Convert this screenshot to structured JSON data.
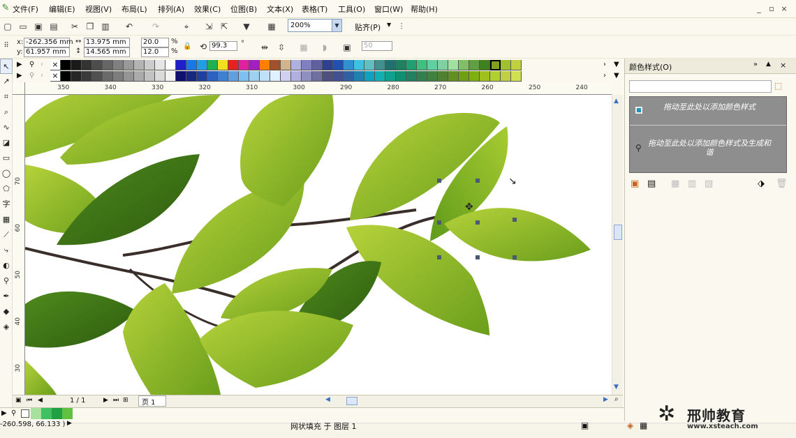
{
  "menubar": {
    "items": [
      "文件(F)",
      "编辑(E)",
      "视图(V)",
      "布局(L)",
      "排列(A)",
      "效果(C)",
      "位图(B)",
      "文本(X)",
      "表格(T)",
      "工具(O)",
      "窗口(W)",
      "帮助(H)"
    ],
    "win_controls": [
      "_",
      "▫",
      "×"
    ]
  },
  "toolbar": {
    "zoom_value": "200%",
    "snap_label": "贴齐(P)"
  },
  "property_bar": {
    "x_label": "x:",
    "y_label": "y:",
    "x_value": "-262.356 mm",
    "y_value": "61.957 mm",
    "width_value": "13.975 mm",
    "height_value": "14.565 mm",
    "scale_w": "20.0",
    "scale_h": "12.0",
    "percent": "%",
    "rotation_value": "99.3",
    "degree": "°",
    "disabled_value": "50"
  },
  "palette": {
    "row1": [
      "#000000",
      "#1a1a1a",
      "#333333",
      "#4d4d4d",
      "#666666",
      "#808080",
      "#999999",
      "#b3b3b3",
      "#cccccc",
      "#e6e6e6",
      "#ffffff",
      "#2020c8",
      "#1878e8",
      "#20a0e0",
      "#20b050",
      "#f0e020",
      "#e82020",
      "#e020a0",
      "#a020c0",
      "#ff8000",
      "#a0522d",
      "#d2b48c",
      "#b0b0e0",
      "#8080c0",
      "#6060a0",
      "#304090",
      "#2050b0",
      "#3090d0",
      "#40c0e0",
      "#60c0c0",
      "#409090",
      "#207070",
      "#208060",
      "#20a070",
      "#40c080",
      "#60d0a0",
      "#80d0a0",
      "#a0e0a0",
      "#80c060",
      "#60a040",
      "#408020",
      "#80a020",
      "#a0c030",
      "#c0d040"
    ],
    "row2": [
      "#000000",
      "#262626",
      "#3a3a3a",
      "#505050",
      "#6a6a6a",
      "#7d7d7d",
      "#949494",
      "#ababab",
      "#c2c2c2",
      "#dadada",
      "#f2f2f2",
      "#101070",
      "#182880",
      "#2040a0",
      "#3060c0",
      "#4080d0",
      "#60a0e0",
      "#80c0f0",
      "#a0d0f0",
      "#c0e0f8",
      "#e0f0ff",
      "#d0d0f0",
      "#b0b0e0",
      "#9090c0",
      "#7070a0",
      "#505080",
      "#405090",
      "#3060a0",
      "#2080b0",
      "#10a0c0",
      "#10b0b0",
      "#10a090",
      "#109070",
      "#208060",
      "#308050",
      "#408040",
      "#508030",
      "#609020",
      "#70a010",
      "#80b010",
      "#a0c020",
      "#b0d030",
      "#c0d040",
      "#d0e050"
    ]
  },
  "ruler": {
    "h_ticks": [
      "350",
      "340",
      "330",
      "320",
      "310",
      "300",
      "290",
      "280",
      "270",
      "260",
      "250",
      "240"
    ],
    "v_ticks": [
      "70",
      "60",
      "50",
      "40",
      "30"
    ]
  },
  "pagebar": {
    "page_count": "1 / 1",
    "page_tab": "页 1"
  },
  "docker": {
    "title": "颜色样式(O)",
    "slot1": "拖动至此处以添加颜色样式",
    "slot2": "拖动至此处以添加颜色样式及生成和谐"
  },
  "status": {
    "coords": "-260.598, 66.133 )",
    "fill_info": "网状填充 于 图层 1",
    "fill_swatches": [
      "#a8e0a0",
      "#40c060",
      "#20a040",
      "#60c040"
    ]
  },
  "watermark": {
    "name": "邢帅教育",
    "url": "www.xsteach.com"
  }
}
